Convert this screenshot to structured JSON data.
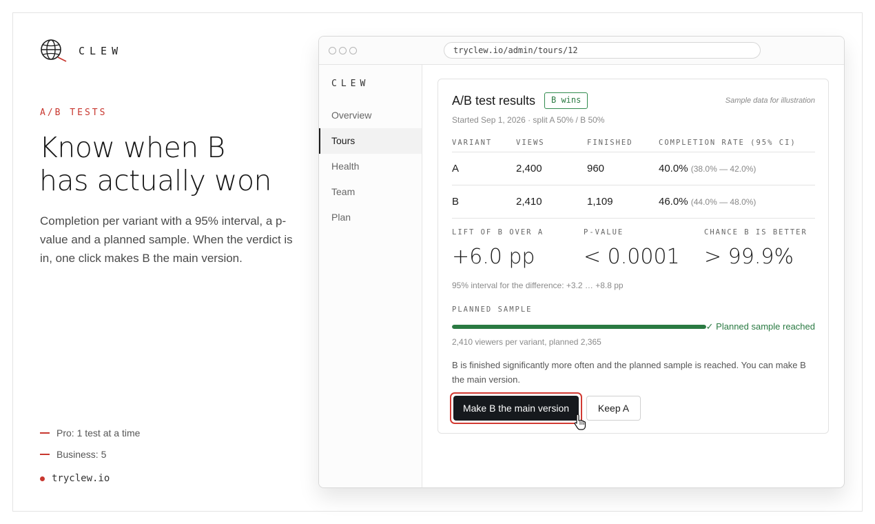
{
  "brand": {
    "name": "CLEW",
    "logo_icon": "globe-magnifier-icon"
  },
  "hero": {
    "eyebrow": "A/B TESTS",
    "headline_line1": "Know when B",
    "headline_line2": "has actually won",
    "description": "Completion per variant with a 95% interval, a p-value and a planned sample. When the verdict is in, one click makes B the main version."
  },
  "plans": [
    {
      "label": "Pro: 1 test at a time"
    },
    {
      "label": "Business: 5"
    }
  ],
  "site": "tryclew.io",
  "colors": {
    "accent": "#c8372f",
    "success": "#2a7a42",
    "button_dark": "#16191d"
  },
  "browser": {
    "url": "tryclew.io/admin/tours/12",
    "sidebar": {
      "brand": "CLEW",
      "items": [
        {
          "label": "Overview",
          "active": false
        },
        {
          "label": "Tours",
          "active": true
        },
        {
          "label": "Health",
          "active": false
        },
        {
          "label": "Team",
          "active": false
        },
        {
          "label": "Plan",
          "active": false
        }
      ]
    }
  },
  "results": {
    "title": "A/B test results",
    "badge": "B wins",
    "sample_note": "Sample data for illustration",
    "subline": "Started Sep 1, 2026 · split A 50% / B 50%",
    "columns": [
      "VARIANT",
      "VIEWS",
      "FINISHED",
      "COMPLETION RATE (95% CI)"
    ],
    "rows": [
      {
        "variant": "A",
        "views": "2,400",
        "finished": "960",
        "rate": "40.0%",
        "ci": "(38.0% — 42.0%)"
      },
      {
        "variant": "B",
        "views": "2,410",
        "finished": "1,109",
        "rate": "46.0%",
        "ci": "(44.0% — 48.0%)"
      }
    ],
    "stats": {
      "lift_label": "LIFT OF B OVER A",
      "lift_value": "+6.0 pp",
      "pvalue_label": "P-VALUE",
      "pvalue_value": "< 0.0001",
      "chance_label": "CHANCE B IS BETTER",
      "chance_value": "> 99.9%"
    },
    "diff_note": "95% interval for the difference: +3.2 … +8.8 pp",
    "planned_sample": {
      "label": "PLANNED SAMPLE",
      "progress_fraction": 1.0,
      "status": "✓ Planned sample reached",
      "viewers_note": "2,410 viewers per variant, planned 2,365"
    },
    "verdict": "B is finished significantly more often and the planned sample is reached. You can make B the main version.",
    "primary_button": "Make B the main version",
    "secondary_button": "Keep A"
  }
}
